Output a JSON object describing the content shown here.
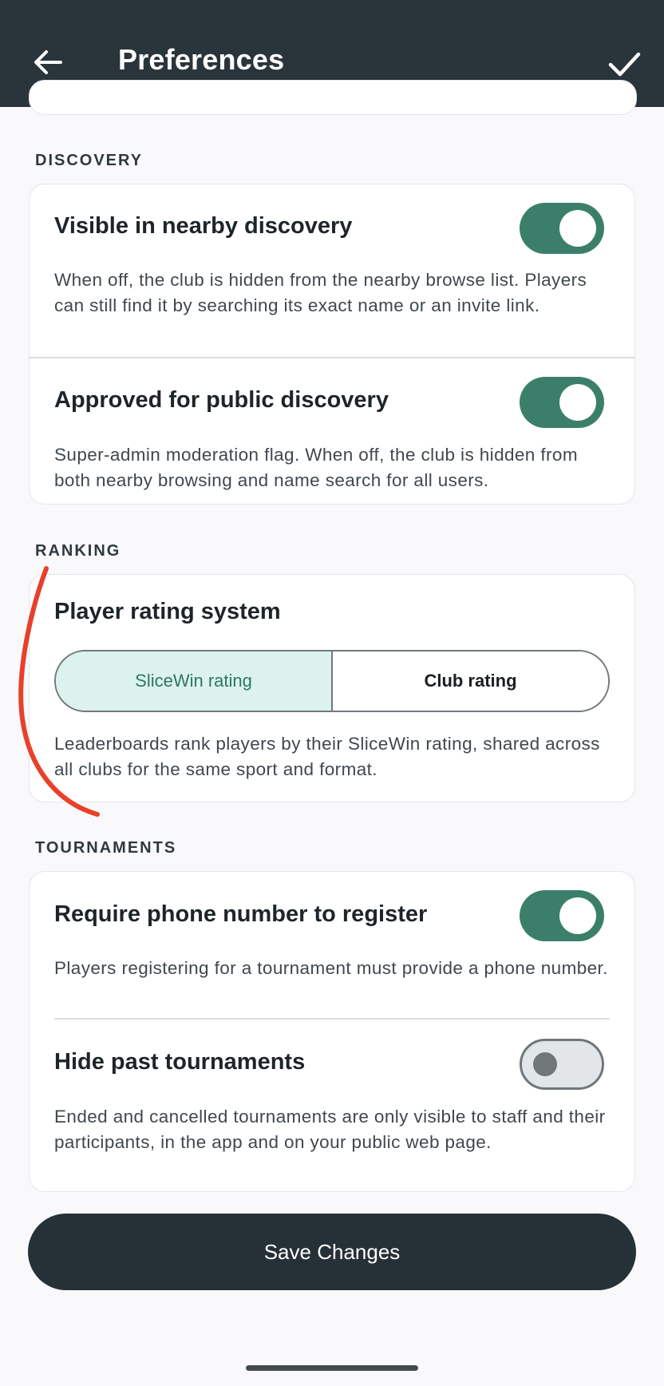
{
  "appbar": {
    "title": "Preferences",
    "back_icon": "arrow-left-icon",
    "confirm_icon": "check-icon"
  },
  "sections": {
    "discovery": {
      "label": "DISCOVERY",
      "items": [
        {
          "title": "Visible in nearby discovery",
          "description": "When off, the club is hidden from the nearby browse list. Players can still find it by searching its exact name or an invite link.",
          "enabled": true
        },
        {
          "title": "Approved for public discovery",
          "description": "Super-admin moderation flag. When off, the club is hidden from both nearby browsing and name search for all users.",
          "enabled": true
        }
      ]
    },
    "ranking": {
      "label": "RANKING",
      "title": "Player rating system",
      "options": [
        "SliceWin rating",
        "Club rating"
      ],
      "selected": "SliceWin rating",
      "description": "Leaderboards rank players by their SliceWin rating, shared across all clubs for the same sport and format."
    },
    "tournaments": {
      "label": "TOURNAMENTS",
      "items": [
        {
          "title": "Require phone number to register",
          "description": "Players registering for a tournament must provide a phone number.",
          "enabled": true
        },
        {
          "title": "Hide past tournaments",
          "description": "Ended and cancelled tournaments are only visible to staff and their participants, in the app and on your public web page.",
          "enabled": false
        }
      ]
    }
  },
  "save_button": {
    "label": "Save Changes"
  },
  "colors": {
    "appbar": "#2a353b",
    "toggle_on": "#3b7f6b",
    "segment_selected_bg": "#dcf2ec",
    "segment_selected_text": "#2f7763",
    "annotation": "#e8402a"
  }
}
